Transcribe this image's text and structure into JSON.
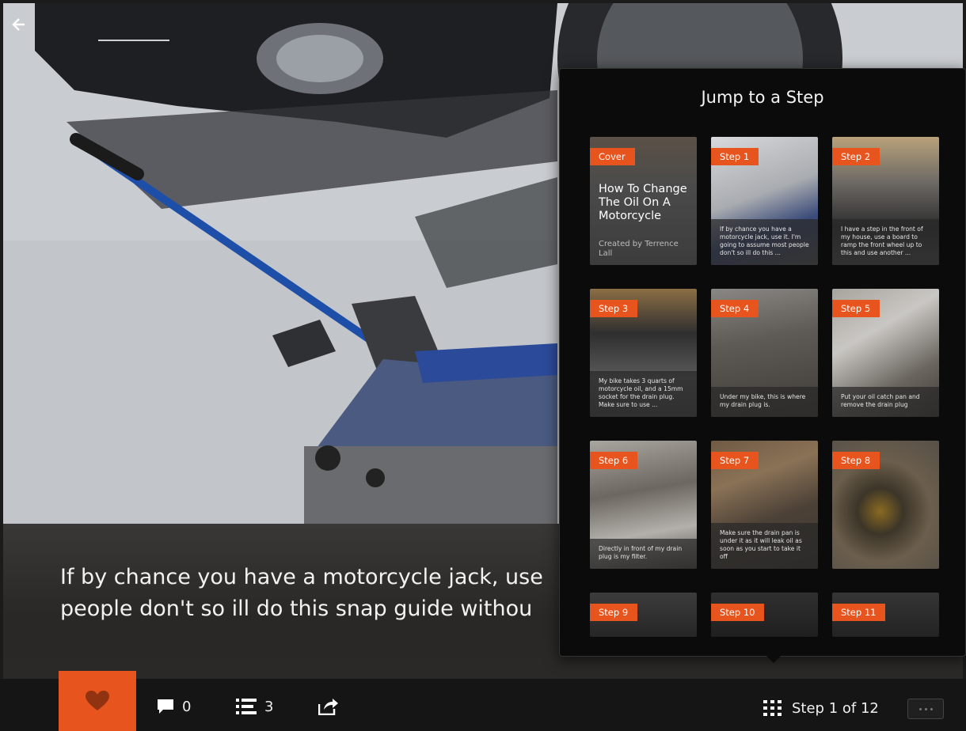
{
  "caption": {
    "line1": "If by chance you have a motorcycle jack, use",
    "line2": "people don't so ill do this snap guide withou"
  },
  "toolbar": {
    "comments_count": "0",
    "steps_count": "3",
    "step_indicator": "Step 1 of 12"
  },
  "popover": {
    "title": "Jump to a Step",
    "cover": {
      "badge": "Cover",
      "title": "How To Change The Oil On A Motorcycle",
      "author": "Created by Terrence Lall"
    },
    "steps": [
      {
        "badge": "Step 1",
        "desc": "If by chance you have a motorcycle jack, use it. I'm going to assume most people don't so ill do this ..."
      },
      {
        "badge": "Step 2",
        "desc": "I have a step in the front of my house, use a board to ramp the front wheel up to this and use another ..."
      },
      {
        "badge": "Step 3",
        "desc": "My bike takes 3 quarts of motorcycle oil, and a 15mm socket for the drain plug. Make sure to use ..."
      },
      {
        "badge": "Step 4",
        "desc": "Under my bike, this is where my drain plug is."
      },
      {
        "badge": "Step 5",
        "desc": "Put your oil catch pan and remove the drain plug"
      },
      {
        "badge": "Step 6",
        "desc": "Directly in front of my drain plug is my filter."
      },
      {
        "badge": "Step 7",
        "desc": "Make sure the drain pan is under it as it will leak oil as soon as you start to take it off"
      },
      {
        "badge": "Step 8",
        "desc": ""
      },
      {
        "badge": "Step 9",
        "desc": ""
      },
      {
        "badge": "Step 10",
        "desc": ""
      },
      {
        "badge": "Step 11",
        "desc": ""
      }
    ]
  },
  "colors": {
    "accent": "#e8541e",
    "toolbar_bg": "#151515",
    "popover_bg": "#0b0b0b"
  },
  "icons": [
    "back-arrow-icon",
    "heart-icon",
    "comment-icon",
    "list-icon",
    "share-icon",
    "grid-icon",
    "more-icon"
  ]
}
